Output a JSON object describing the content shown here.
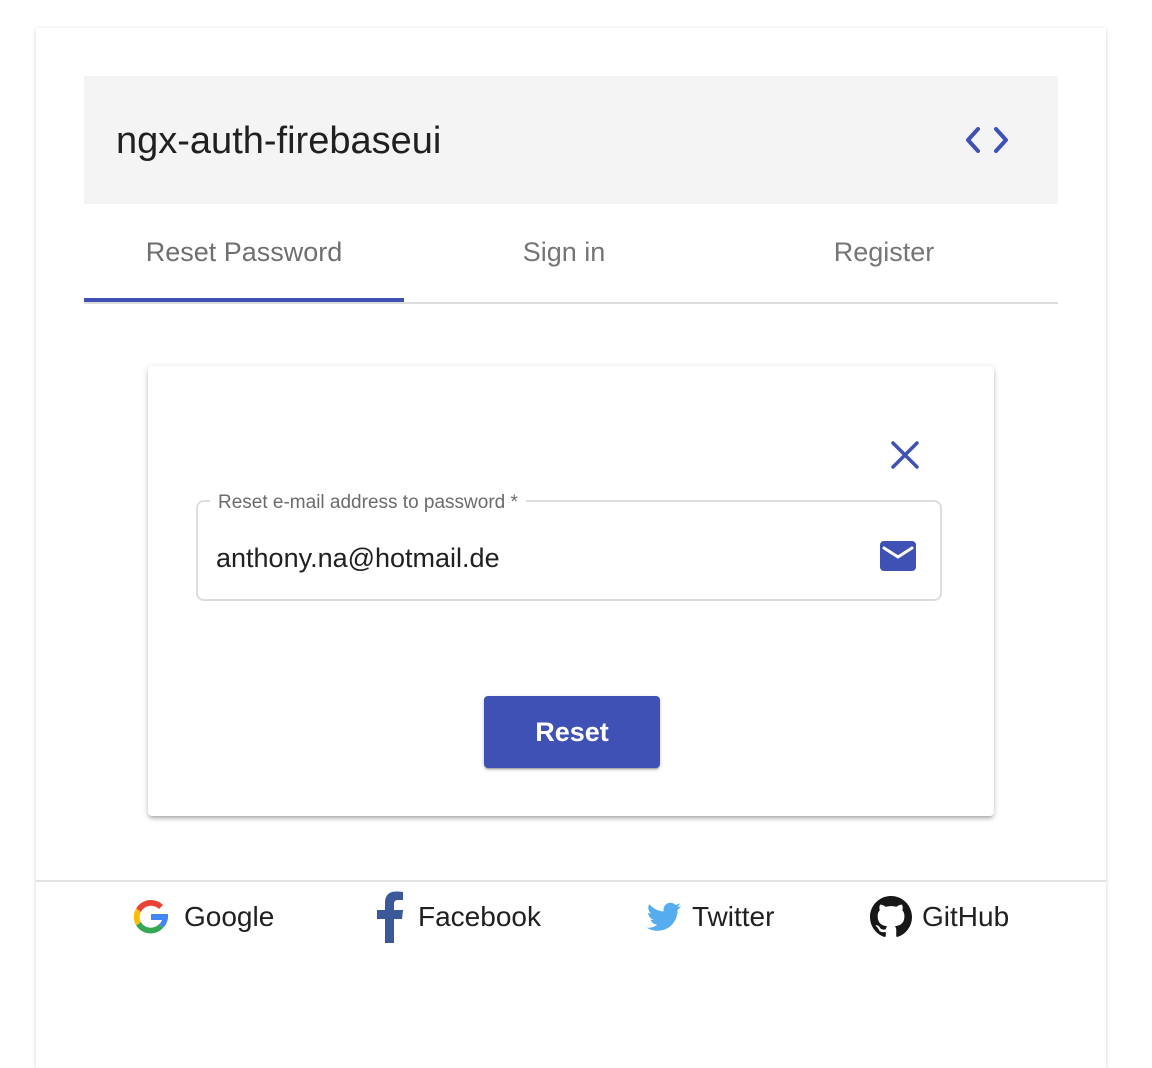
{
  "toolbar": {
    "title": "ngx-auth-firebaseui",
    "code_icon": "code-brackets-icon",
    "background": "#f4f4f4"
  },
  "tabs": [
    {
      "label": "Reset Password",
      "active": true
    },
    {
      "label": "Sign in",
      "active": false
    },
    {
      "label": "Register",
      "active": false
    }
  ],
  "reset_form": {
    "close_icon": "close-icon",
    "field": {
      "label": "Reset e-mail address to password *",
      "value": "anthony.na@hotmail.de",
      "icon": "mail-icon"
    },
    "submit_label": "Reset"
  },
  "providers": [
    {
      "label": "Google",
      "icon": "google-icon"
    },
    {
      "label": "Facebook",
      "icon": "facebook-icon"
    },
    {
      "label": "Twitter",
      "icon": "twitter-icon"
    },
    {
      "label": "GitHub",
      "icon": "github-icon"
    }
  ],
  "colors": {
    "primary": "#3f51b5",
    "google_blue": "#4285f4",
    "google_red": "#ea4335",
    "google_yellow": "#fbbc05",
    "google_green": "#34a853",
    "facebook": "#3b5998",
    "twitter": "#55acee",
    "github": "#181717"
  }
}
